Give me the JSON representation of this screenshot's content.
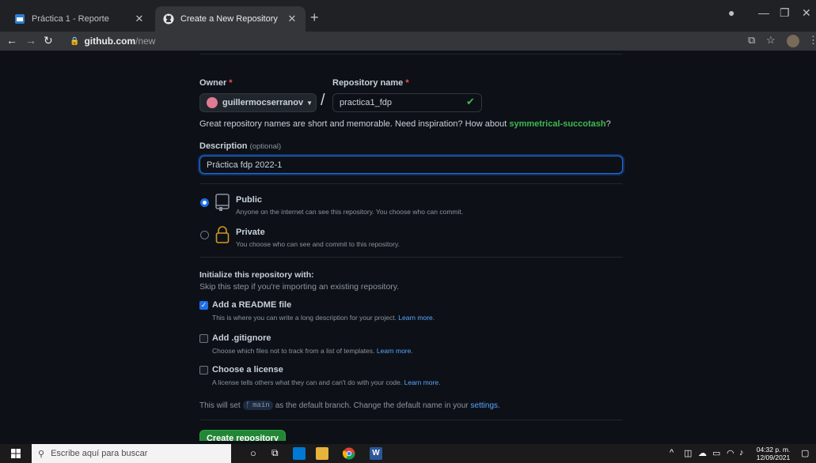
{
  "browser": {
    "tabs": [
      {
        "title": "Práctica 1 - Reporte",
        "active": false
      },
      {
        "title": "Create a New Repository",
        "active": true
      }
    ],
    "url_host": "github.com",
    "url_path": "/new"
  },
  "form": {
    "owner_label": "Owner",
    "required_mark": "*",
    "owner_value": "guillermocserranov",
    "repo_label": "Repository name",
    "repo_value": "practica1_fdp",
    "hint_text": "Great repository names are short and memorable. Need inspiration? How about",
    "hint_suggestion": "symmetrical-succotash",
    "hint_end": "?",
    "description_label": "Description",
    "description_optional": "(optional)",
    "description_value": "Práctica fdp 2022-1",
    "visibility": {
      "public_title": "Public",
      "public_desc": "Anyone on the internet can see this repository. You choose who can commit.",
      "private_title": "Private",
      "private_desc": "You choose who can see and commit to this repository.",
      "selected": "public"
    },
    "init_title": "Initialize this repository with:",
    "init_sub": "Skip this step if you're importing an existing repository.",
    "readme_label": "Add a README file",
    "readme_desc": "This is where you can write a long description for your project.",
    "readme_checked": true,
    "gitignore_label": "Add .gitignore",
    "gitignore_desc": "Choose which files not to track from a list of templates.",
    "license_label": "Choose a license",
    "license_desc": "A license tells others what they can and can't do with your code.",
    "learn_more": "Learn more.",
    "branch_note_pre": "This will set",
    "branch_name": "main",
    "branch_note_post": "as the default branch. Change the default name in your",
    "settings_link": "settings",
    "branch_note_end": ".",
    "create_button": "Create repository"
  },
  "taskbar": {
    "search_placeholder": "Escribe aquí para buscar",
    "time": "04:32 p. m.",
    "date": "12/09/2021"
  },
  "colors": {
    "accent_green": "#238636",
    "link_blue": "#58a6ff",
    "success_green": "#3fb950",
    "required_red": "#f85149"
  }
}
